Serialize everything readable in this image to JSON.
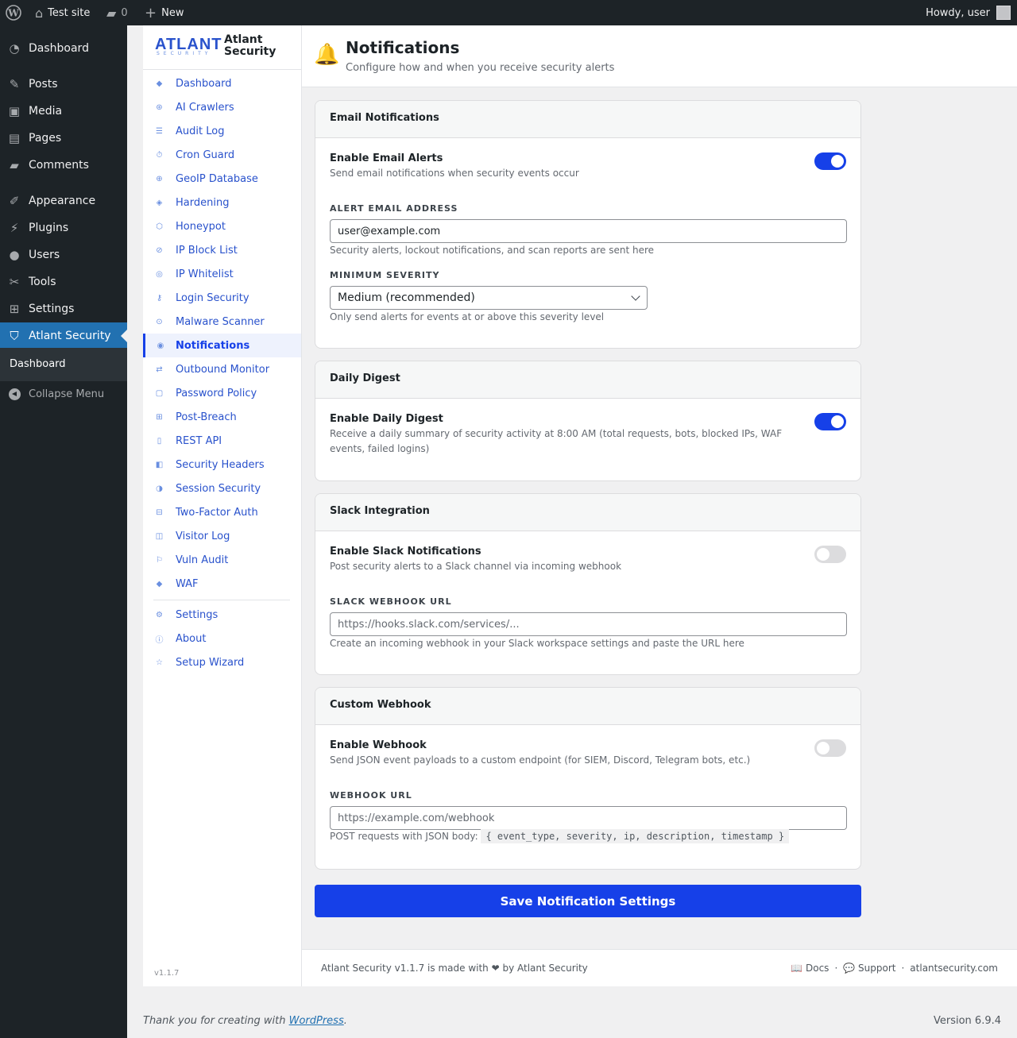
{
  "admin_bar": {
    "site_name": "Test site",
    "comment_count": "0",
    "new_label": "New",
    "greeting": "Howdy, user"
  },
  "wp_menu": {
    "items": [
      {
        "label": "Dashboard",
        "icon": "dashboard-icon"
      },
      {
        "label": "Posts",
        "icon": "pin-icon"
      },
      {
        "label": "Media",
        "icon": "media-icon"
      },
      {
        "label": "Pages",
        "icon": "page-icon"
      },
      {
        "label": "Comments",
        "icon": "comment-icon"
      },
      {
        "label": "Appearance",
        "icon": "brush-icon"
      },
      {
        "label": "Plugins",
        "icon": "plug-icon"
      },
      {
        "label": "Users",
        "icon": "user-icon"
      },
      {
        "label": "Tools",
        "icon": "wrench-icon"
      },
      {
        "label": "Settings",
        "icon": "settings-icon"
      },
      {
        "label": "Atlant Security",
        "icon": "shield-icon"
      }
    ],
    "submenu_dashboard": "Dashboard",
    "collapse_label": "Collapse Menu"
  },
  "plugin_sidebar": {
    "logo_text": "ATLANT",
    "logo_sub": "SECURITY",
    "brand_name": "Atlant Security",
    "items": [
      {
        "label": "Dashboard",
        "icon": "◆"
      },
      {
        "label": "AI Crawlers",
        "icon": "⊛"
      },
      {
        "label": "Audit Log",
        "icon": "☰"
      },
      {
        "label": "Cron Guard",
        "icon": "⏱"
      },
      {
        "label": "GeoIP Database",
        "icon": "⊕"
      },
      {
        "label": "Hardening",
        "icon": "◈"
      },
      {
        "label": "Honeypot",
        "icon": "⬡"
      },
      {
        "label": "IP Block List",
        "icon": "⊘"
      },
      {
        "label": "IP Whitelist",
        "icon": "◎"
      },
      {
        "label": "Login Security",
        "icon": "⚷"
      },
      {
        "label": "Malware Scanner",
        "icon": "⊙"
      },
      {
        "label": "Notifications",
        "icon": "◉"
      },
      {
        "label": "Outbound Monitor",
        "icon": "⇄"
      },
      {
        "label": "Password Policy",
        "icon": "▢"
      },
      {
        "label": "Post-Breach",
        "icon": "⊞"
      },
      {
        "label": "REST API",
        "icon": "▯"
      },
      {
        "label": "Security Headers",
        "icon": "◧"
      },
      {
        "label": "Session Security",
        "icon": "◑"
      },
      {
        "label": "Two-Factor Auth",
        "icon": "⊟"
      },
      {
        "label": "Visitor Log",
        "icon": "◫"
      },
      {
        "label": "Vuln Audit",
        "icon": "⚐"
      },
      {
        "label": "WAF",
        "icon": "◆"
      }
    ],
    "bottom_items": [
      {
        "label": "Settings",
        "icon": "⚙"
      },
      {
        "label": "About",
        "icon": "ⓘ"
      },
      {
        "label": "Setup Wizard",
        "icon": "☆"
      }
    ],
    "version": "v1.1.7"
  },
  "page": {
    "title": "Notifications",
    "subtitle": "Configure how and when you receive security alerts",
    "icon": "bell-icon"
  },
  "email": {
    "header": "Email Notifications",
    "enable_title": "Enable Email Alerts",
    "enable_desc": "Send email notifications when security events occur",
    "enabled": true,
    "address_label": "ALERT EMAIL ADDRESS",
    "address_value": "user@example.com",
    "address_help": "Security alerts, lockout notifications, and scan reports are sent here",
    "severity_label": "MINIMUM SEVERITY",
    "severity_value": "Medium (recommended)",
    "severity_help": "Only send alerts for events at or above this severity level"
  },
  "digest": {
    "header": "Daily Digest",
    "enable_title": "Enable Daily Digest",
    "enable_desc_1": "Receive a daily summary of security activity at 8:00 AM (total requests, bots, blocked IPs, WAF",
    "enable_desc_2": "events, failed logins)",
    "enabled": true
  },
  "slack": {
    "header": "Slack Integration",
    "enable_title": "Enable Slack Notifications",
    "enable_desc": "Post security alerts to a Slack channel via incoming webhook",
    "enabled": false,
    "url_label": "SLACK WEBHOOK URL",
    "url_placeholder": "https://hooks.slack.com/services/...",
    "url_help": "Create an incoming webhook in your Slack workspace settings and paste the URL here"
  },
  "webhook": {
    "header": "Custom Webhook",
    "enable_title": "Enable Webhook",
    "enable_desc": "Send JSON event payloads to a custom endpoint (for SIEM, Discord, Telegram bots, etc.)",
    "enabled": false,
    "url_label": "WEBHOOK URL",
    "url_placeholder": "https://example.com/webhook",
    "help_prefix": "POST requests with JSON body:",
    "help_code": "{ event_type, severity, ip, description, timestamp }"
  },
  "save_label": "Save Notification Settings",
  "plugin_footer": {
    "text": "Atlant Security v1.1.7 is made with ❤ by Atlant Security",
    "docs": "📖 Docs",
    "sep": "·",
    "support": "💬 Support",
    "site": "atlantsecurity.com"
  },
  "wp_footer": {
    "thanks": "Thank you for creating with",
    "link": "WordPress",
    "period": ".",
    "version": "Version 6.9.4"
  }
}
